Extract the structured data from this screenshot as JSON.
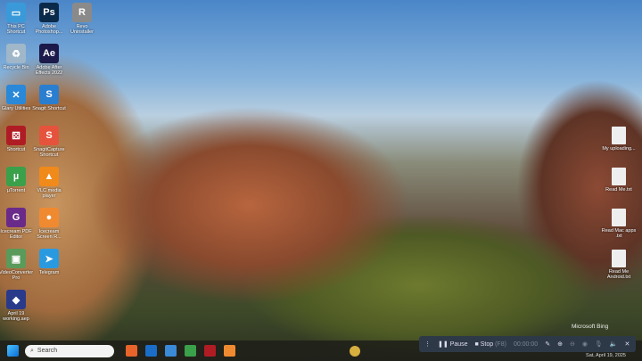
{
  "desktop_icons_left": [
    {
      "label": "This PC Shortcut",
      "color": "#3a9ad9",
      "glyph": "▭"
    },
    {
      "label": "Adobe Photoshop...",
      "color": "#0b2a4a",
      "glyph": "Ps"
    },
    {
      "label": "Revo Uninstaller",
      "color": "#8a8a8a",
      "glyph": "R"
    },
    {
      "label": "Recycle Bin",
      "color": "#9fb7c9",
      "glyph": "♻"
    },
    {
      "label": "Adobe After Effects 2022",
      "color": "#1b1a4b",
      "glyph": "Ae"
    },
    {
      "label": "Glary Utilities",
      "color": "#2a88d8",
      "glyph": "✕"
    },
    {
      "label": "Snagit Shortcut",
      "color": "#2a7ed0",
      "glyph": "S"
    },
    {
      "label": "Shortcut",
      "color": "#b01c24",
      "glyph": "⚄"
    },
    {
      "label": "SnagitCapture Shortcut",
      "color": "#e5533d",
      "glyph": "S"
    },
    {
      "label": "µTorrent",
      "color": "#3aa04a",
      "glyph": "µ"
    },
    {
      "label": "VLC media player",
      "color": "#f08a1a",
      "glyph": "▲"
    },
    {
      "label": "Icecream PDF Editor",
      "color": "#6a2a8a",
      "glyph": "G"
    },
    {
      "label": "Icecream Screen R...",
      "color": "#f08a30",
      "glyph": "●"
    },
    {
      "label": "VideoConverter Pro",
      "color": "#5a9a5a",
      "glyph": "▣"
    },
    {
      "label": "Telegram",
      "color": "#2a9ae0",
      "glyph": "➤"
    },
    {
      "label": "April 19 working.aep",
      "color": "#2a3a8a",
      "glyph": "◆"
    }
  ],
  "desktop_icons_right": [
    {
      "label": "My uploading..."
    },
    {
      "label": "Read Me.txt"
    },
    {
      "label": "Read Mac apps .txt"
    },
    {
      "label": "Read Me Android.txt"
    }
  ],
  "bing_label": "Microsoft Bing",
  "taskbar": {
    "search_placeholder": "Search",
    "apps": [
      {
        "name": "firefox",
        "color": "#e8642a"
      },
      {
        "name": "outlook",
        "color": "#1a6ec8"
      },
      {
        "name": "notepad",
        "color": "#3a8ad8"
      },
      {
        "name": "utorrent",
        "color": "#3aa04a"
      },
      {
        "name": "game",
        "color": "#b01c24"
      },
      {
        "name": "icecream-screen",
        "color": "#f08a30"
      }
    ]
  },
  "recorder": {
    "pause": "Pause",
    "stop": "Stop",
    "stop_key": "(F8)",
    "timer": "00:00:00"
  },
  "clock": "Sat, April 19, 2025"
}
